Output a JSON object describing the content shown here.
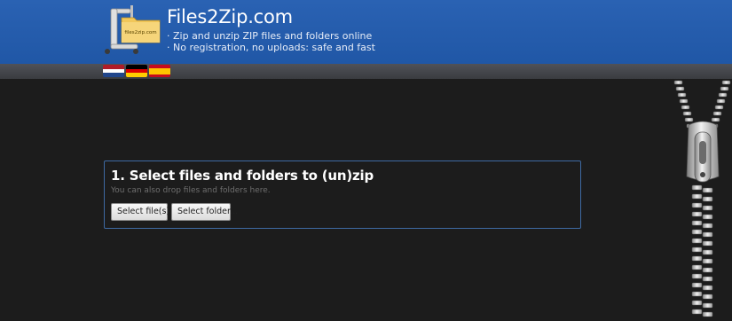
{
  "header": {
    "title": "Files2Zip.com",
    "logo_label": "files2zip.com",
    "taglines": [
      "· Zip and unzip ZIP files and folders online",
      "· No registration, no uploads: safe and fast"
    ]
  },
  "languages": [
    {
      "name": "Dutch",
      "icon": "flag-netherlands-icon"
    },
    {
      "name": "German",
      "icon": "flag-germany-icon"
    },
    {
      "name": "Spanish",
      "icon": "flag-spain-icon"
    }
  ],
  "panel": {
    "title": "1. Select files and folders to (un)zip",
    "hint": "You can also drop files and folders here.",
    "buttons": {
      "select_files": "Select file(s)...",
      "select_folder": "Select folder..."
    }
  },
  "colors": {
    "header_blue": "#2259aa",
    "page_background": "#1c1c1c",
    "panel_border": "#3e6aa3"
  }
}
